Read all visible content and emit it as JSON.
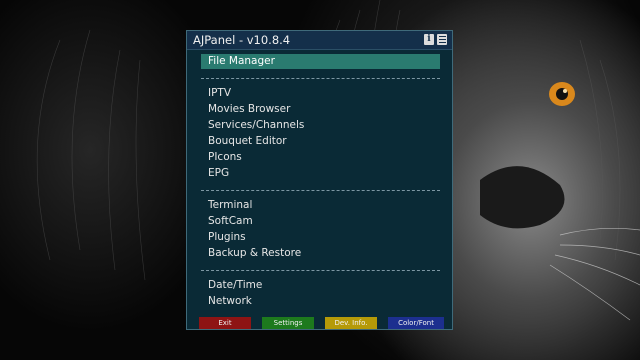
{
  "window": {
    "title": "AJPanel - v10.8.4",
    "info_icon": "info-icon",
    "menu_icon": "hamburger-menu-icon"
  },
  "menu": {
    "selected": "File Manager",
    "groups": [
      [
        "File Manager"
      ],
      [
        "IPTV",
        "Movies Browser",
        "Services/Channels",
        "Bouquet Editor",
        "PIcons",
        "EPG"
      ],
      [
        "Terminal",
        "SoftCam",
        "Plugins",
        "Backup & Restore"
      ],
      [
        "Date/Time",
        "Network"
      ]
    ]
  },
  "footer": {
    "red": "Exit",
    "green": "Settings",
    "yellow": "Dev. Info.",
    "blue": "Color/Font"
  },
  "colors": {
    "panel_bg": "#0a2a36",
    "title_bg": "#142f4a",
    "selected_bg": "#2a7b70",
    "red": "#8e1414",
    "green": "#1d7a1d",
    "yellow": "#b59a08",
    "blue": "#1c2f8f",
    "lion_eye": "#d9881c"
  }
}
